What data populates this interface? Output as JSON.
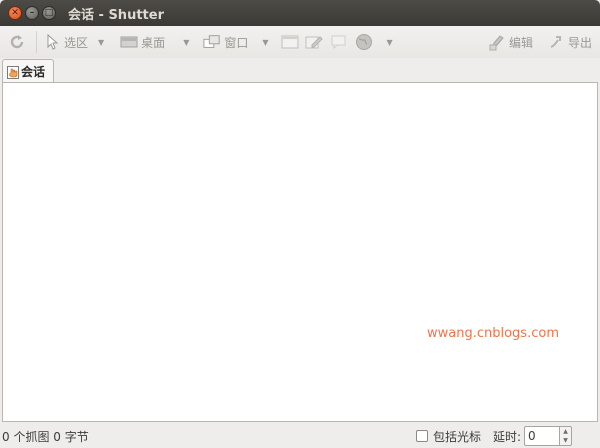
{
  "window": {
    "title": "会话 - Shutter"
  },
  "toolbar": {
    "select_label": "选区",
    "desktop_label": "桌面",
    "window_label": "窗口",
    "edit_label": "编辑",
    "export_label": "导出",
    "dropdown_glyph": "▼"
  },
  "tabs": [
    {
      "label": "会话"
    }
  ],
  "content": {
    "watermark": "wwang.cnblogs.com"
  },
  "statusbar": {
    "summary": "0 个抓图  0 字节",
    "include_cursor_label": "包括光标",
    "delay_label": "延时:",
    "delay_value": "0"
  },
  "colors": {
    "watermark": "#f0734a",
    "titlebar": "#3b3a36",
    "close_button": "#d94c1b"
  }
}
